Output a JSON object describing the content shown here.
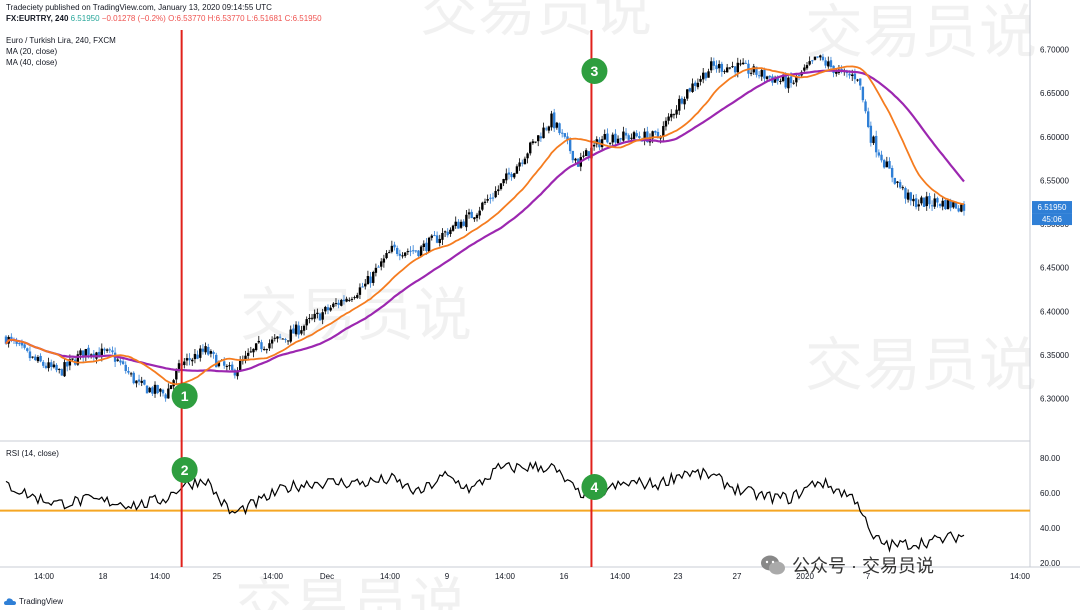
{
  "header": {
    "line1": "Tradeciety published on TradingView.com, January 13, 2020 09:14:55 UTC",
    "line2_symbol": "FX:EURTRY, 240",
    "line2_price": "6.51950",
    "line2_change": "−0.01278 (−0.2%)",
    "line2_ohlc": "O:6.53770 H:6.53770 L:6.51681 C:6.51950",
    "legend_title": "Euro / Turkish Lira, 240, FXCM",
    "ma20": "MA (20, close)",
    "ma40": "MA (40, close)",
    "rsi_label": "RSI (14, close)"
  },
  "colors": {
    "candle_up": "#000000",
    "candle_down": "#2f7fd6",
    "ma20": "#f57c1f",
    "ma40": "#9c27b0",
    "rsi": "#000000",
    "rsi_level": "#f5a623",
    "vline": "#e0211b",
    "marker": "#2e9e3f",
    "price_tag": "#2f7fd6"
  },
  "chart_data": {
    "type": "candlestick",
    "price_axis": {
      "ticks": [
        "6.70000",
        "6.65000",
        "6.60000",
        "6.55000",
        "6.50000",
        "6.45000",
        "6.40000",
        "6.35000",
        "6.30000"
      ],
      "min": 6.255,
      "max": 6.72
    },
    "rsi_axis": {
      "ticks": [
        "80.00",
        "60.00",
        "40.00",
        "20.00"
      ],
      "min": 20,
      "max": 87
    },
    "x_axis_ticks": [
      "14:00",
      "18",
      "14:00",
      "25",
      "14:00",
      "Dec",
      "14:00",
      "9",
      "14:00",
      "16",
      "14:00",
      "23",
      "27",
      "2020",
      "7",
      "14:00"
    ],
    "last_price_tag": "6.51950",
    "countdown_tag": "45:06",
    "rsi_level": 50,
    "vertical_lines": [
      {
        "candle": 66,
        "markers": [
          "1",
          "2"
        ]
      },
      {
        "candle": 220,
        "markers": [
          "3",
          "4"
        ]
      }
    ],
    "close_keypoints": [
      [
        0,
        6.37
      ],
      [
        10,
        6.345
      ],
      [
        20,
        6.33
      ],
      [
        30,
        6.355
      ],
      [
        40,
        6.35
      ],
      [
        50,
        6.315
      ],
      [
        60,
        6.305
      ],
      [
        66,
        6.34
      ],
      [
        75,
        6.355
      ],
      [
        80,
        6.34
      ],
      [
        85,
        6.33
      ],
      [
        95,
        6.36
      ],
      [
        105,
        6.37
      ],
      [
        115,
        6.39
      ],
      [
        125,
        6.41
      ],
      [
        135,
        6.43
      ],
      [
        145,
        6.47
      ],
      [
        155,
        6.47
      ],
      [
        165,
        6.49
      ],
      [
        175,
        6.51
      ],
      [
        185,
        6.54
      ],
      [
        195,
        6.58
      ],
      [
        205,
        6.62
      ],
      [
        215,
        6.57
      ],
      [
        225,
        6.6
      ],
      [
        235,
        6.6
      ],
      [
        245,
        6.6
      ],
      [
        255,
        6.65
      ],
      [
        265,
        6.68
      ],
      [
        275,
        6.68
      ],
      [
        285,
        6.67
      ],
      [
        295,
        6.66
      ],
      [
        305,
        6.69
      ],
      [
        315,
        6.67
      ],
      [
        320,
        6.67
      ],
      [
        325,
        6.6
      ],
      [
        332,
        6.56
      ],
      [
        340,
        6.525
      ],
      [
        350,
        6.525
      ],
      [
        360,
        6.52
      ]
    ],
    "rsi_keypoints": [
      [
        0,
        65
      ],
      [
        10,
        58
      ],
      [
        20,
        54
      ],
      [
        30,
        56
      ],
      [
        40,
        55
      ],
      [
        50,
        53
      ],
      [
        60,
        57
      ],
      [
        66,
        64
      ],
      [
        75,
        68
      ],
      [
        80,
        57
      ],
      [
        85,
        48
      ],
      [
        95,
        55
      ],
      [
        105,
        63
      ],
      [
        115,
        66
      ],
      [
        125,
        66
      ],
      [
        135,
        66
      ],
      [
        145,
        68
      ],
      [
        155,
        60
      ],
      [
        165,
        70
      ],
      [
        175,
        62
      ],
      [
        185,
        74
      ],
      [
        195,
        75
      ],
      [
        205,
        75
      ],
      [
        215,
        60
      ],
      [
        225,
        62
      ],
      [
        235,
        66
      ],
      [
        245,
        65
      ],
      [
        255,
        72
      ],
      [
        265,
        70
      ],
      [
        275,
        62
      ],
      [
        285,
        58
      ],
      [
        295,
        57
      ],
      [
        305,
        67
      ],
      [
        315,
        60
      ],
      [
        320,
        56
      ],
      [
        325,
        35
      ],
      [
        332,
        30
      ],
      [
        340,
        31
      ],
      [
        350,
        33
      ],
      [
        360,
        36
      ]
    ],
    "candle_count": 361
  },
  "footer": {
    "brand": "TradingView",
    "watermark": "交易员说",
    "wechat": "公众号 · 交易员说"
  }
}
